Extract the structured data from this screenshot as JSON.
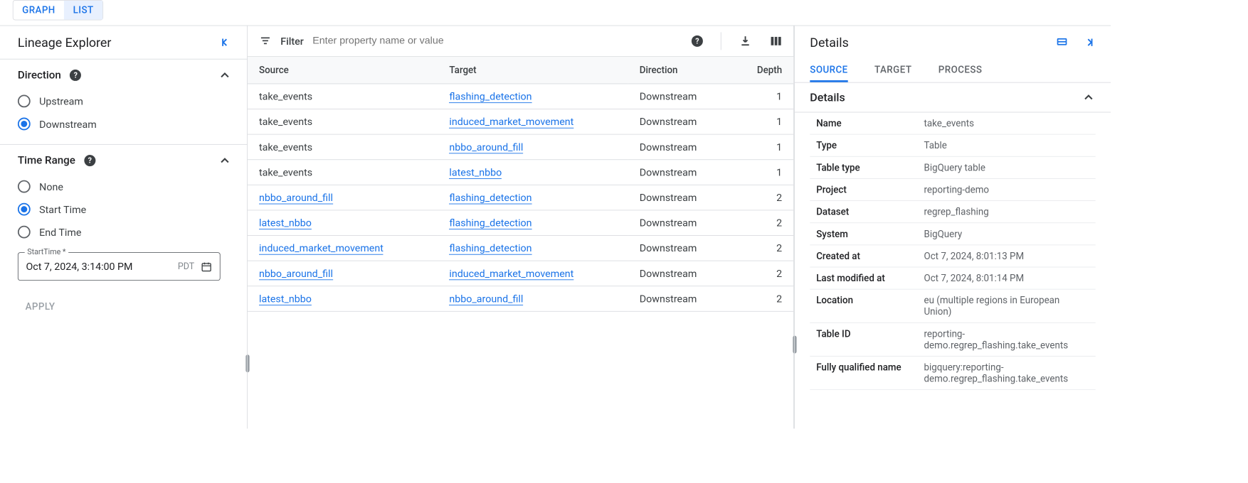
{
  "topTabs": {
    "graph": "GRAPH",
    "list": "LIST",
    "active": "list"
  },
  "sidebar": {
    "title": "Lineage Explorer",
    "direction": {
      "title": "Direction",
      "options": {
        "upstream": "Upstream",
        "downstream": "Downstream"
      },
      "selected": "downstream"
    },
    "timeRange": {
      "title": "Time Range",
      "options": {
        "none": "None",
        "start": "Start Time",
        "end": "End Time"
      },
      "selected": "start",
      "fieldLabel": "StartTime *",
      "fieldValue": "Oct 7, 2024, 3:14:00 PM",
      "tz": "PDT"
    },
    "apply": "APPLY"
  },
  "filter": {
    "label": "Filter",
    "placeholder": "Enter property name or value"
  },
  "table": {
    "headers": {
      "source": "Source",
      "target": "Target",
      "direction": "Direction",
      "depth": "Depth"
    },
    "rows": [
      {
        "source": "take_events",
        "sourceLink": false,
        "target": "flashing_detection",
        "targetLink": true,
        "direction": "Downstream",
        "depth": "1"
      },
      {
        "source": "take_events",
        "sourceLink": false,
        "target": "induced_market_movement",
        "targetLink": true,
        "direction": "Downstream",
        "depth": "1"
      },
      {
        "source": "take_events",
        "sourceLink": false,
        "target": "nbbo_around_fill",
        "targetLink": true,
        "direction": "Downstream",
        "depth": "1"
      },
      {
        "source": "take_events",
        "sourceLink": false,
        "target": "latest_nbbo",
        "targetLink": true,
        "direction": "Downstream",
        "depth": "1"
      },
      {
        "source": "nbbo_around_fill",
        "sourceLink": true,
        "target": "flashing_detection",
        "targetLink": true,
        "direction": "Downstream",
        "depth": "2"
      },
      {
        "source": "latest_nbbo",
        "sourceLink": true,
        "target": "flashing_detection",
        "targetLink": true,
        "direction": "Downstream",
        "depth": "2"
      },
      {
        "source": "induced_market_movement",
        "sourceLink": true,
        "target": "flashing_detection",
        "targetLink": true,
        "direction": "Downstream",
        "depth": "2"
      },
      {
        "source": "nbbo_around_fill",
        "sourceLink": true,
        "target": "induced_market_movement",
        "targetLink": true,
        "direction": "Downstream",
        "depth": "2"
      },
      {
        "source": "latest_nbbo",
        "sourceLink": true,
        "target": "nbbo_around_fill",
        "targetLink": true,
        "direction": "Downstream",
        "depth": "2"
      }
    ]
  },
  "details": {
    "title": "Details",
    "tabs": {
      "source": "SOURCE",
      "target": "TARGET",
      "process": "PROCESS",
      "active": "source"
    },
    "sectionTitle": "Details",
    "props": [
      {
        "key": "Name",
        "val": "take_events"
      },
      {
        "key": "Type",
        "val": "Table"
      },
      {
        "key": "Table type",
        "val": "BigQuery table"
      },
      {
        "key": "Project",
        "val": "reporting-demo"
      },
      {
        "key": "Dataset",
        "val": "regrep_flashing"
      },
      {
        "key": "System",
        "val": "BigQuery"
      },
      {
        "key": "Created at",
        "val": "Oct 7, 2024, 8:01:13 PM"
      },
      {
        "key": "Last modified at",
        "val": "Oct 7, 2024, 8:01:14 PM"
      },
      {
        "key": "Location",
        "val": "eu (multiple regions in European Union)"
      },
      {
        "key": "Table ID",
        "val": "reporting-demo.regrep_flashing.take_events"
      },
      {
        "key": "Fully qualified name",
        "val": "bigquery:reporting-demo.regrep_flashing.take_events"
      }
    ]
  }
}
